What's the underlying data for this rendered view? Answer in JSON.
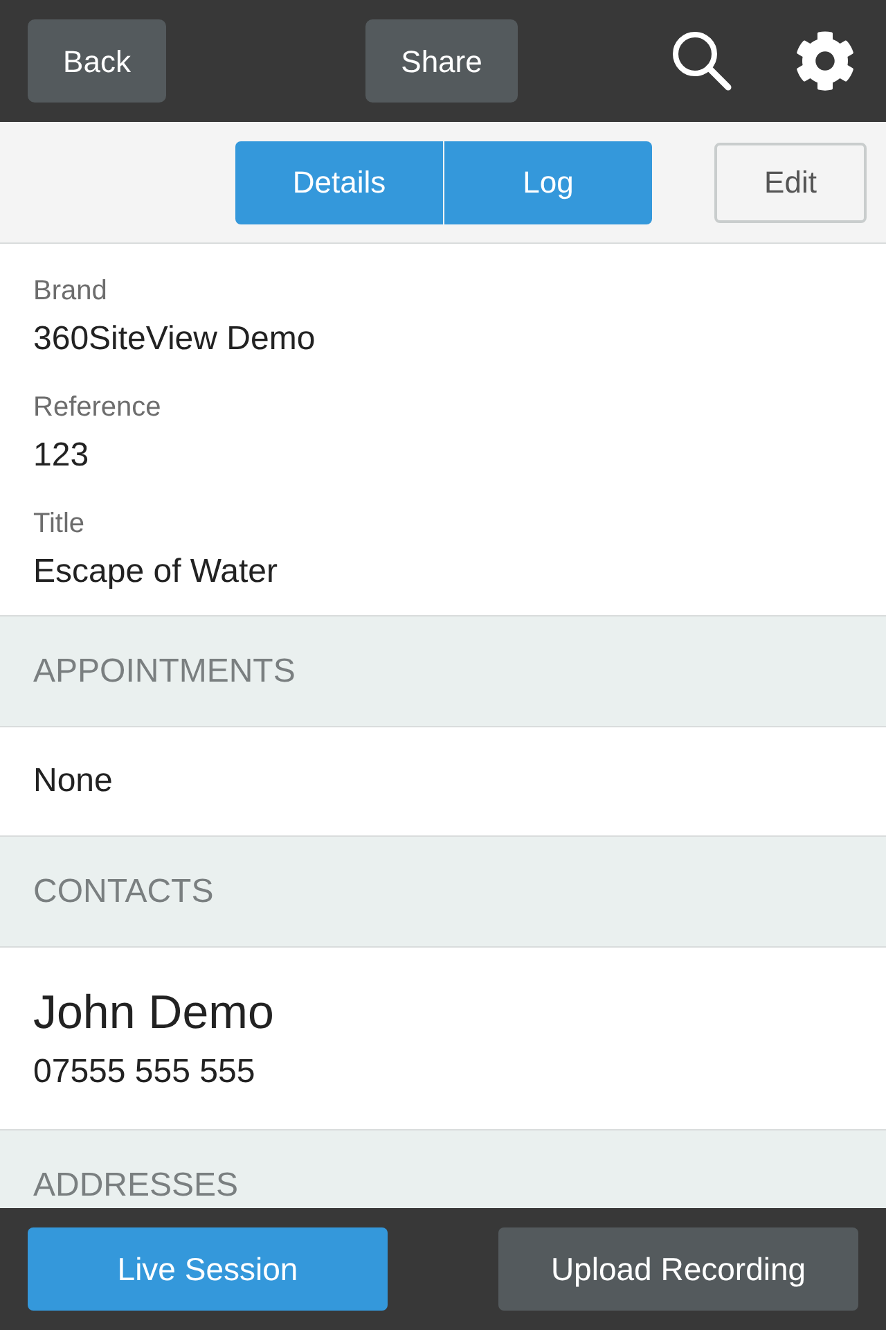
{
  "top_bar": {
    "buttons": [
      {
        "label": "Back"
      },
      {
        "label": "Share"
      }
    ]
  },
  "tabs": [
    {
      "label": "Details"
    },
    {
      "label": "Log"
    }
  ],
  "edit_button": {
    "label": "Edit"
  },
  "details": [
    {
      "label": "Brand",
      "value": "360SiteView Demo"
    },
    {
      "label": "Reference",
      "value": "123"
    },
    {
      "label": "Title",
      "value": "Escape of Water"
    }
  ],
  "sections": [
    {
      "heading": "APPOINTMENTS",
      "kind": "text",
      "items": [
        "None"
      ]
    },
    {
      "heading": "CONTACTS",
      "kind": "contact",
      "items": [
        {
          "name": "John Demo",
          "phone": "07555 555 555"
        }
      ]
    },
    {
      "heading": "ADDRESSES"
    }
  ],
  "bottom_bar": {
    "buttons": [
      {
        "label": "Live Session",
        "kind": "primary"
      },
      {
        "label": "Upload Recording",
        "kind": "secondary"
      }
    ]
  }
}
